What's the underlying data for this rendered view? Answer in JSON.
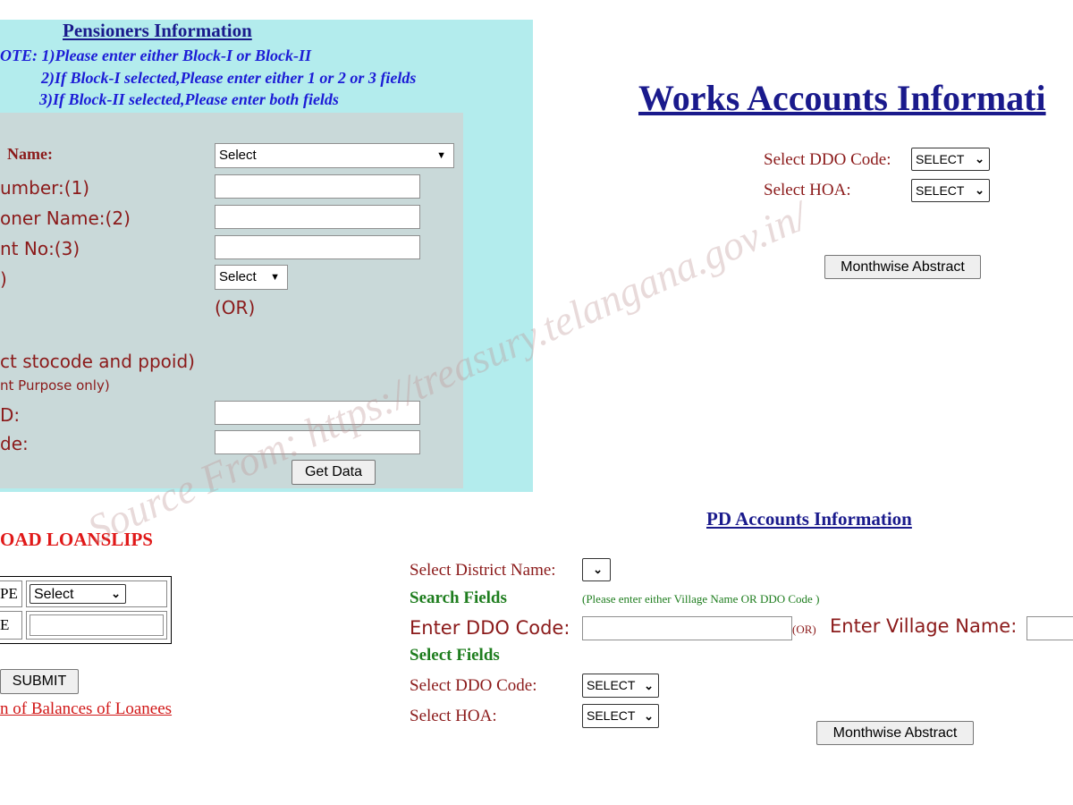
{
  "pensioners": {
    "title": "Pensioners Information",
    "note_line1": "OTE: 1)Please enter either Block-I or Block-II",
    "note_line2": "2)If Block-I selected,Please enter either 1 or 2 or 3 fields",
    "note_line3": "3)If Block-II selected,Please enter both fields",
    "name_label": "Name:",
    "name_select": "Select",
    "number_label": "umber:(1)",
    "pensioner_name_label": "oner Name:(2)",
    "account_label": "nt No:(3)",
    "paren_label": ")",
    "small_select": "Select",
    "or_label": "(OR)",
    "stocode_label": "ct stocode and ppoid)",
    "purpose_label": "nt Purpose only)",
    "d_label": "D:",
    "de_label": "de:",
    "get_data": "Get Data"
  },
  "loanslips": {
    "title": "OAD LOANSLIPS",
    "row1_label": "PE",
    "row1_select": "Select",
    "row2_label": "E",
    "submit": "SUBMIT",
    "balances_link": "n of Balances of Loanees"
  },
  "works": {
    "title": "Works Accounts Informati",
    "ddo_label": "Select DDO Code:",
    "ddo_select": "SELECT",
    "hoa_label": "Select HOA:",
    "hoa_select": "SELECT",
    "monthwise": "Monthwise Abstract"
  },
  "pd": {
    "title": "PD Accounts Information",
    "district_label": "Select District Name:",
    "search_fields": "Search Fields",
    "search_hint": "(Please enter either Village Name OR DDO Code )",
    "enter_ddo_label": "Enter DDO Code:",
    "or_label": "(OR)",
    "enter_village_label": "Enter Village Name:",
    "select_fields": "Select Fields",
    "ddo_label": "Select DDO Code:",
    "ddo_select": "SELECT",
    "hoa_label": "Select HOA:",
    "hoa_select": "SELECT",
    "monthwise": "Monthwise Abstract"
  },
  "watermark": "Source From: https://treasury.telangana.gov.in/"
}
